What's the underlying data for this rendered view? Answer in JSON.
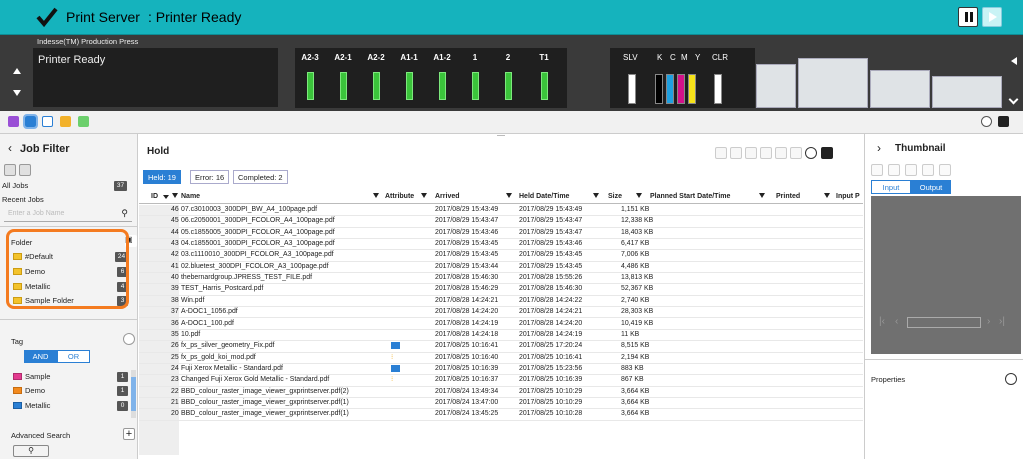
{
  "title": {
    "app": "Print Server",
    "status": ": Printer Ready"
  },
  "printer": {
    "product_name": "Indesse(TM) Production Press",
    "state": "Printer Ready",
    "trays": [
      "A2-3",
      "A2-1",
      "A2-2",
      "A1-1",
      "A1-2",
      "1",
      "2",
      "T1"
    ],
    "toner_labels": [
      "SLV",
      "K",
      "C",
      "M",
      "Y",
      "CLR"
    ]
  },
  "colors": {
    "accent": "#15b3bd",
    "selected": "#2a7fd4",
    "highlight": "#f47b20"
  },
  "left": {
    "header": "Job Filter",
    "all_jobs_label": "All Jobs",
    "all_jobs_count": "37",
    "recent_jobs": "Recent Jobs",
    "search_placeholder": "Enter a Job Name",
    "folder_label": "Folder",
    "folders": [
      {
        "name": "#Default",
        "count": "24"
      },
      {
        "name": "Demo",
        "count": "6"
      },
      {
        "name": "Metallic",
        "count": "4"
      },
      {
        "name": "Sample Folder",
        "count": "3"
      }
    ],
    "tag_label": "Tag",
    "and_label": "AND",
    "or_label": "OR",
    "tags": [
      {
        "name": "Sample",
        "count": "1",
        "color": "#e33a8f"
      },
      {
        "name": "Demo",
        "count": "1",
        "color": "#f28a1e"
      },
      {
        "name": "Metallic",
        "count": "0",
        "color": "#2a7fd4"
      }
    ],
    "advanced_search": "Advanced Search"
  },
  "center": {
    "title": "Hold",
    "tabs": {
      "held": "Held: 19",
      "error": "Error: 16",
      "completed": "Completed: 2"
    },
    "columns": {
      "id": "ID",
      "name": "Name",
      "attribute": "Attribute",
      "arrived": "Arrived",
      "held": "Held Date/Time",
      "size": "Size",
      "planned": "Planned Start Date/Time",
      "printed": "Printed",
      "input": "Input P"
    },
    "rows": [
      {
        "id": "46",
        "name": "07.c3010003_300DPI_BW_A4_100page.pdf",
        "tag": "",
        "arrived": "2017/08/29 15:43:49",
        "held": "2017/08/29 15:43:49",
        "size": "1,151 KB"
      },
      {
        "id": "45",
        "name": "06.c2050001_300DPI_FCOLOR_A4_100page.pdf",
        "tag": "",
        "arrived": "2017/08/29 15:43:47",
        "held": "2017/08/29 15:43:47",
        "size": "12,338 KB"
      },
      {
        "id": "44",
        "name": "05.c1855005_300DPI_FCOLOR_A4_100page.pdf",
        "tag": "",
        "arrived": "2017/08/29 15:43:46",
        "held": "2017/08/29 15:43:47",
        "size": "18,403 KB"
      },
      {
        "id": "43",
        "name": "04.c1855001_300DPI_FCOLOR_A3_100page.pdf",
        "tag": "",
        "arrived": "2017/08/29 15:43:45",
        "held": "2017/08/29 15:43:46",
        "size": "6,417 KB"
      },
      {
        "id": "42",
        "name": "03.c1110010_300DPI_FCOLOR_A3_100page.pdf",
        "tag": "",
        "arrived": "2017/08/29 15:43:45",
        "held": "2017/08/29 15:43:45",
        "size": "7,006 KB"
      },
      {
        "id": "41",
        "name": "02.bluetest_300DPI_FCOLOR_A3_100page.pdf",
        "tag": "",
        "arrived": "2017/08/29 15:43:44",
        "held": "2017/08/29 15:43:45",
        "size": "4,486 KB"
      },
      {
        "id": "40",
        "name": "thebernardgroup.JPRESS_TEST_FILE.pdf",
        "tag": "",
        "arrived": "2017/08/28 15:46:30",
        "held": "2017/08/28 15:55:26",
        "size": "13,813 KB"
      },
      {
        "id": "39",
        "name": "TEST_Harris_Postcard.pdf",
        "tag": "",
        "arrived": "2017/08/28 15:46:29",
        "held": "2017/08/28 15:46:30",
        "size": "52,367 KB"
      },
      {
        "id": "38",
        "name": "Win.pdf",
        "tag": "",
        "arrived": "2017/08/28 14:24:21",
        "held": "2017/08/28 14:24:22",
        "size": "2,740 KB"
      },
      {
        "id": "37",
        "name": "A-DOC1_1056.pdf",
        "tag": "",
        "arrived": "2017/08/28 14:24:20",
        "held": "2017/08/28 14:24:21",
        "size": "28,303 KB"
      },
      {
        "id": "36",
        "name": "A-DOC1_100.pdf",
        "tag": "",
        "arrived": "2017/08/28 14:24:19",
        "held": "2017/08/28 14:24:20",
        "size": "10,419 KB"
      },
      {
        "id": "35",
        "name": "10.pdf",
        "tag": "",
        "arrived": "2017/08/28 14:24:18",
        "held": "2017/08/28 14:24:19",
        "size": "11 KB"
      },
      {
        "id": "26",
        "name": "fx_ps_silver_geometry_Fix.pdf",
        "tag": "blue",
        "arrived": "2017/08/25 10:16:41",
        "held": "2017/08/25 17:20:24",
        "size": "8,515 KB"
      },
      {
        "id": "25",
        "name": "fx_ps_gold_koi_mod.pdf",
        "tag": "dots",
        "arrived": "2017/08/25 10:16:40",
        "held": "2017/08/25 10:16:41",
        "size": "2,194 KB"
      },
      {
        "id": "24",
        "name": "Fuji Xerox Metallic - Standard.pdf",
        "tag": "blue",
        "arrived": "2017/08/25 10:16:39",
        "held": "2017/08/25 15:23:56",
        "size": "883 KB"
      },
      {
        "id": "23",
        "name": "Changed Fuji Xerox Gold Metallic - Standard.pdf",
        "tag": "dots",
        "arrived": "2017/08/25 10:16:37",
        "held": "2017/08/25 10:16:39",
        "size": "867 KB"
      },
      {
        "id": "22",
        "name": "BBD_colour_raster_image_viewer_gxprintserver.pdf(2)",
        "tag": "",
        "arrived": "2017/08/24 13:49:34",
        "held": "2017/08/25 10:10:29",
        "size": "3,664 KB"
      },
      {
        "id": "21",
        "name": "BBD_colour_raster_image_viewer_gxprintserver.pdf(1)",
        "tag": "",
        "arrived": "2017/08/24 13:47:00",
        "held": "2017/08/25 10:10:29",
        "size": "3,664 KB"
      },
      {
        "id": "20",
        "name": "BBD_colour_raster_image_viewer_gxprintserver.pdf(1)",
        "tag": "",
        "arrived": "2017/08/24 13:45:25",
        "held": "2017/08/25 10:10:28",
        "size": "3,664 KB"
      }
    ]
  },
  "right": {
    "header": "Thumbnail",
    "input_label": "Input",
    "output_label": "Output",
    "properties_label": "Properties"
  }
}
